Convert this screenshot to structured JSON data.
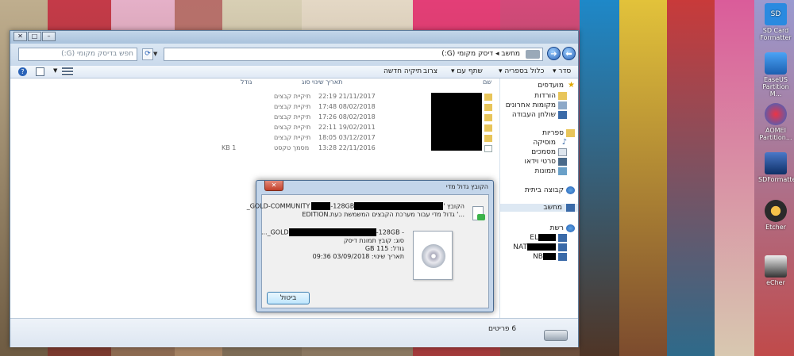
{
  "explorer": {
    "address": "מחשב ◂ דיסק מקומי (G:)",
    "search_placeholder": "חפש בדיסק מקומי (G:)",
    "toolbar": {
      "organize": "סדר",
      "include_library": "כלול בספריה",
      "share_with": "שתף עם",
      "burn": "צרוב",
      "new_folder": "תיקיה חדשה"
    },
    "nav": {
      "favorites": "מועדפים",
      "downloads": "הורדות",
      "recent": "מקומות אחרונים",
      "desktop": "שולחן העבודה",
      "libraries": "ספריות",
      "music": "מוסיקה",
      "documents": "מסמכים",
      "videos": "סרטי וידאו",
      "pictures": "תמונות",
      "homegroup": "קבוצה ביתית",
      "computer": "מחשב",
      "network": "רשת",
      "net_items": [
        "EL",
        "NAT",
        "NB"
      ]
    },
    "columns": {
      "name": "שם",
      "date": "תאריך שינוי",
      "type": "סוג",
      "size": "גודל"
    },
    "rows": [
      {
        "date": "21/11/2017 22:19",
        "type": "תיקיית קבצים",
        "size": ""
      },
      {
        "date": "08/02/2018 17:48",
        "type": "תיקיית קבצים",
        "size": ""
      },
      {
        "date": "08/02/2018 17:26",
        "type": "תיקיית קבצים",
        "size": ""
      },
      {
        "date": "19/02/2011 22:11",
        "type": "תיקיית קבצים",
        "size": ""
      },
      {
        "date": "03/12/2017 18:05",
        "type": "תיקיית קבצים",
        "size": ""
      },
      {
        "date": "22/11/2016 13:28",
        "type": "מסמך טקסט",
        "size": "1 KB"
      }
    ],
    "status": "6 פריטים"
  },
  "dialog": {
    "title": "הקובץ גדול מדי",
    "msg_line1_prefix": "הקובץ '",
    "msg_line1_suffix": "GOLD-COMMUNITY",
    "msg_line1_end": "-128GB_",
    "msg_line2_start": "EDITION",
    "msg_line2": "...' גדול מדי עבור מערכת הקבצים המשמשת כעת.",
    "file_name_start": "- GOLD",
    "file_name_end": "-128GB_...",
    "file_type": "סוג: קובץ תמונת דיסק",
    "file_size": "גודל: 115 GB",
    "file_date": "תאריך שינוי: 03/09/2018 09:36",
    "cancel_label": "ביטול"
  },
  "desktop": {
    "icons": [
      {
        "label": "SD Card Formatter"
      },
      {
        "label": "EaseUS Partition M..."
      },
      {
        "label": "AOMEI Partition..."
      },
      {
        "label": "SDFormatter"
      },
      {
        "label": "Etcher"
      },
      {
        "label": "eCher"
      }
    ]
  },
  "colors": {
    "accent": "#2a63b8",
    "titlebar": "#b7cce2",
    "folder": "#e8c55a"
  }
}
